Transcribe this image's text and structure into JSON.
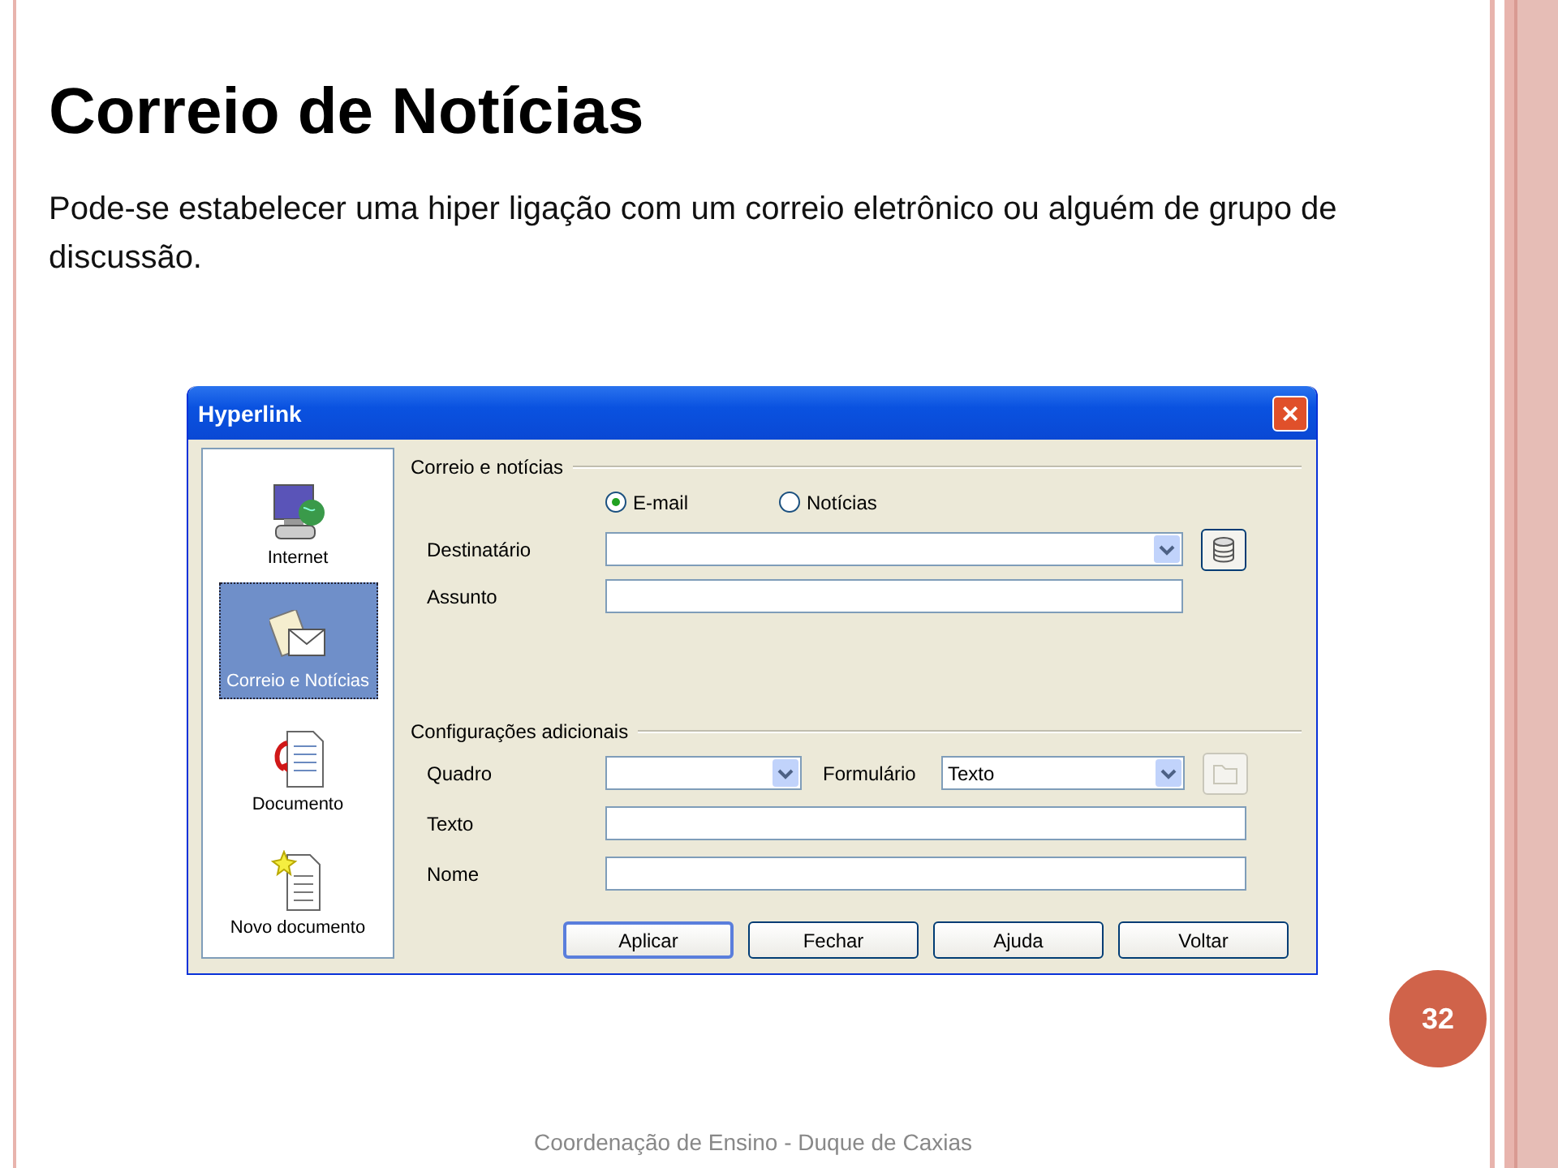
{
  "slide": {
    "title": "Correio de Notícias",
    "text": "Pode-se estabelecer uma hiper ligação com um correio eletrônico ou alguém de grupo de discussão.",
    "page_number": "32",
    "footer": "Coordenação de Ensino - Duque de Caxias"
  },
  "dialog": {
    "title": "Hyperlink",
    "close": "×",
    "categories": [
      {
        "label": "Internet",
        "kind": "internet",
        "selected": false
      },
      {
        "label": "Correio e Notícias",
        "kind": "mail",
        "selected": true
      },
      {
        "label": "Documento",
        "kind": "document",
        "selected": false
      },
      {
        "label": "Novo documento",
        "kind": "new",
        "selected": false
      }
    ],
    "mail_group": {
      "title": "Correio e notícias",
      "options": [
        {
          "label": "E-mail",
          "selected": true
        },
        {
          "label": "Notícias",
          "selected": false
        }
      ],
      "fields": [
        {
          "label": "Destinatário",
          "kind": "combo"
        },
        {
          "label": "Assunto",
          "kind": "text"
        }
      ]
    },
    "extra_group": {
      "title": "Configurações adicionais",
      "frame": {
        "label": "Quadro"
      },
      "form": {
        "label": "Formulário",
        "value": "Texto"
      },
      "folder_disabled": true,
      "fields": [
        {
          "label": "Texto"
        },
        {
          "label": "Nome"
        }
      ]
    },
    "buttons": [
      {
        "label": "Aplicar",
        "default": true
      },
      {
        "label": "Fechar",
        "default": false
      },
      {
        "label": "Ajuda",
        "default": false
      },
      {
        "label": "Voltar",
        "default": false
      }
    ]
  }
}
